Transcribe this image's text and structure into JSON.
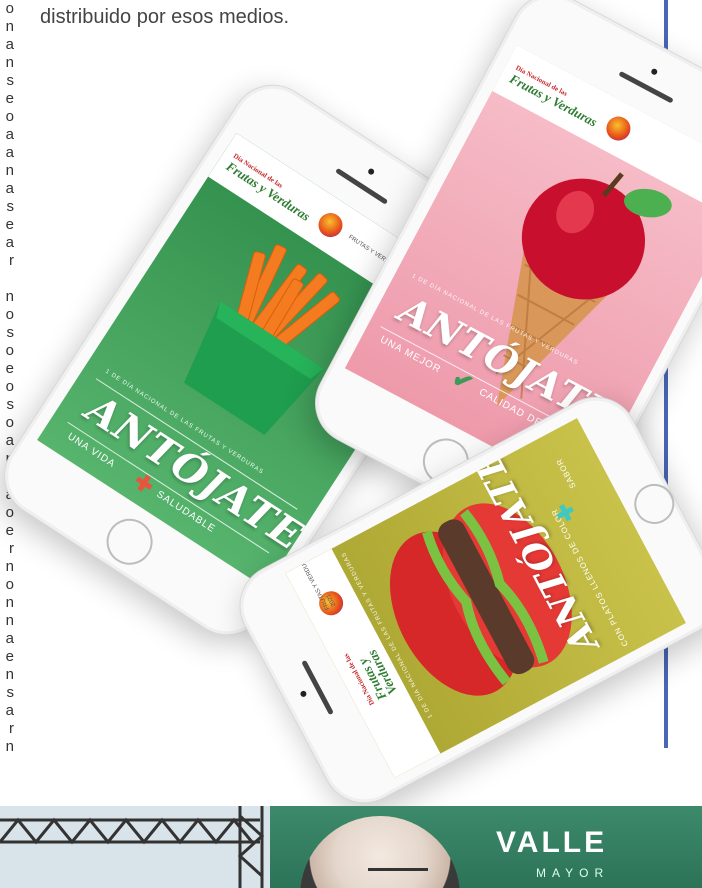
{
  "article": {
    "intro_text": "distribuido por esos medios.",
    "left_column_letters": [
      "o",
      "n",
      "a",
      "n",
      "s",
      "e",
      "o",
      "a",
      "a",
      "n",
      "a",
      "s",
      "e",
      "a",
      "r",
      "",
      "n",
      "o",
      "s",
      "o",
      "e",
      "o",
      "s",
      "o",
      "a",
      "n",
      "e",
      "a",
      "o",
      "e",
      "r",
      "n",
      "o",
      "n",
      "n",
      "a",
      "e",
      "n",
      "s",
      "a",
      "r",
      "n",
      "o"
    ]
  },
  "phones": {
    "carrot": {
      "header_brand": "Frutas y Verduras",
      "header_brand_small": "Día Nacional de las",
      "header_logo_text": "FRUTAS Y VERDURAS 2021",
      "tiny_text": "1 DE DÍA NACIONAL DE LAS FRUTAS Y VERDURAS",
      "banner": "ANTÓJATE",
      "sub_left": "UNA VIDA",
      "sub_right": "SALUDABLE",
      "bg": "#3c9b58",
      "accent": "#e8553d"
    },
    "apple": {
      "header_brand": "Frutas y Verduras",
      "header_brand_small": "Día Nacional de las",
      "tiny_text": "1 DE DÍA NACIONAL DE LAS FRUTAS Y VERDURAS",
      "banner": "ANTÓJATE",
      "sub_left": "UNA MEJOR",
      "sub_right": "CALIDAD DE VIDA",
      "bg": "#f0a8b5",
      "accent": "#3c9b58"
    },
    "tomato": {
      "header_brand": "Frutas y Verduras",
      "header_brand_small": "Día Nacional de las",
      "header_logo_text": "FRUTAS Y VERDURAS 2021",
      "tiny_text": "1 DE DÍA NACIONAL DE LAS FRUTAS Y VERDURAS",
      "banner": "ANTÓJATE",
      "sub_left": "CON PLATOS LLENOS DE COLOR",
      "sub_right": "SABOR",
      "bg": "#b9b23a",
      "accent": "#3fc9c0"
    }
  },
  "bottom_photo": {
    "sign_text": "VALLE",
    "sign_sub": "MAYOR"
  }
}
